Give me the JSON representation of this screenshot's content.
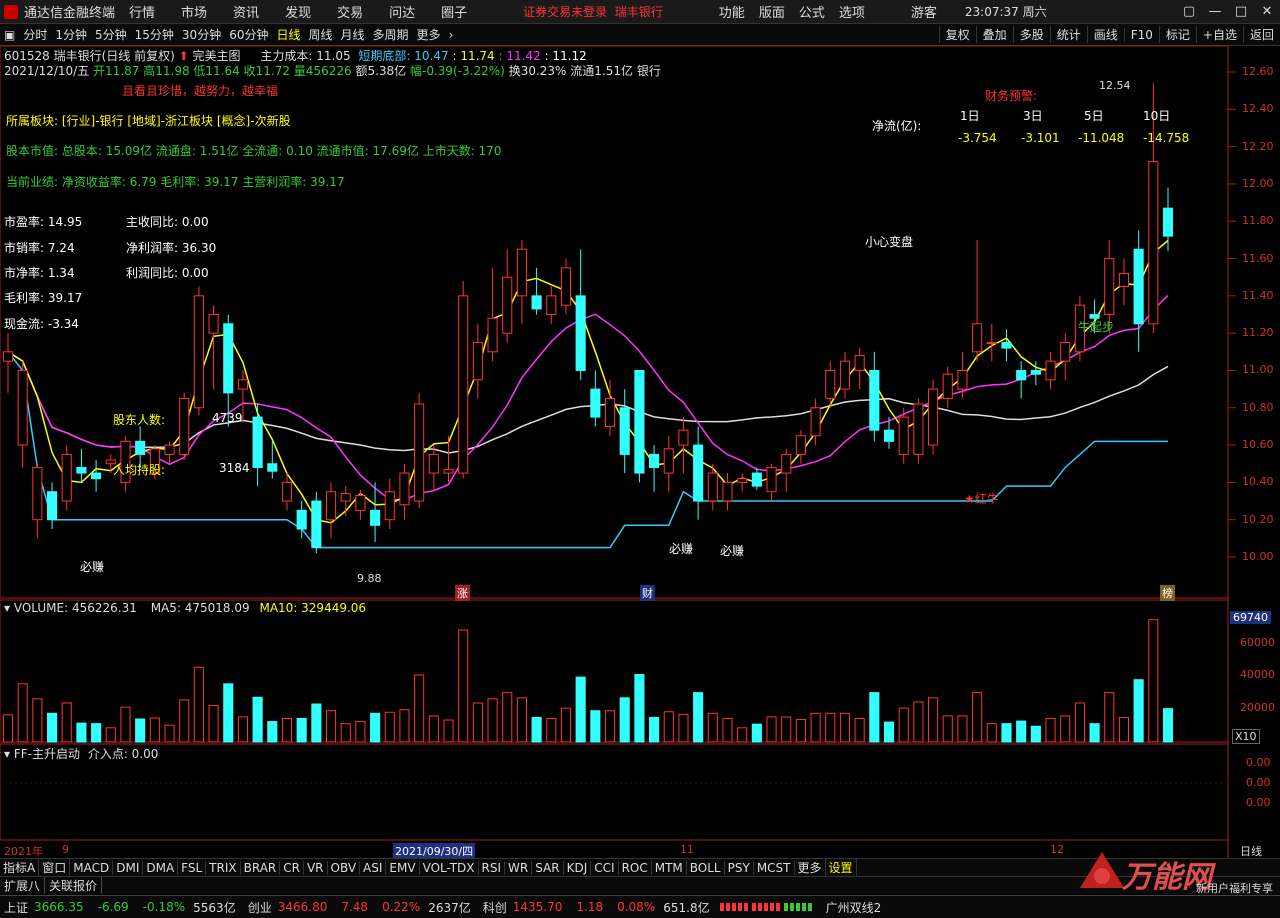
{
  "app": {
    "title": "通达信金融终端",
    "notice": "证券交易未登录",
    "notice_stock": "瑞丰银行",
    "guest": "游客",
    "clock": "23:07:37 周六"
  },
  "menus": [
    "行情",
    "市场",
    "资讯",
    "发现",
    "交易",
    "问达",
    "圈子"
  ],
  "right_menus": [
    "功能",
    "版面",
    "公式",
    "选项"
  ],
  "period_tabs": [
    "分时",
    "1分钟",
    "5分钟",
    "15分钟",
    "30分钟",
    "60分钟",
    "日线",
    "周线",
    "月线",
    "多周期",
    "更多"
  ],
  "active_period": "日线",
  "right_tools": [
    "复权",
    "叠加",
    "多股",
    "统计",
    "画线",
    "F10",
    "标记",
    "+自选",
    "返回"
  ],
  "stock": {
    "header": "601528 瑞丰银行(日线 前复权)",
    "main_chart": "完美主图",
    "cost": "主力成本: 11.05",
    "short_bottom_label": "短期底部:",
    "v1": "10.47",
    "v2": ": 11.74",
    "v3": ": 11.42",
    "v4": ": 11.12",
    "date": "2021/12/10/五",
    "open": "开11.87",
    "high": "高11.98",
    "low": "低11.64",
    "close": "收11.72",
    "volume": "量456226",
    "amount": "额5.38亿",
    "change": "幅-0.39(-3.22%)",
    "turnover": "换30.23%",
    "float": "流通1.51亿",
    "sector": "银行"
  },
  "overlay": {
    "motto": "且看且珍惜，越努力，越幸福",
    "industry": "所属板块: [行业]-银行 [地域]-浙江板块 [概念]-次新股",
    "capital": "股本市值: 总股本: 15.09亿 流通盘: 1.51亿 全流通: 0.10 流通市值: 17.69亿 上市天数: 170",
    "performance": "当前业绩: 净资收益率: 6.79 毛利率: 39.17 主营利润率: 39.17",
    "pe": "市盈率: 14.95",
    "ps": "市销率: 7.24",
    "pb": "市净率: 1.34",
    "gross": "毛利率: 39.17",
    "cashflow": "现金流: -3.34",
    "rev_yoy": "主收同比: 0.00",
    "net_margin": "净利润率: 36.30",
    "profit_yoy": "利润同比: 0.00",
    "holders_label": "股东人数:",
    "holders": "4739",
    "per_holder_label": "人均持股:",
    "per_holder": "3184",
    "finance_warn": "财务预警:",
    "netflow_label": "净流(亿):",
    "netflow_periods": [
      "1日",
      "3日",
      "5日",
      "10日"
    ],
    "netflow_values": [
      "-3.754",
      "-3.101",
      "-11.048",
      "-14.758"
    ],
    "caution": "小心变盘",
    "hongniu": "★红牛",
    "qidong": "牛起步",
    "bizhuan": "必赚",
    "high_mark": "12.54",
    "low_mark": "9.88",
    "zhang": "涨",
    "cai": "财",
    "bang": "榜"
  },
  "price_axis": [
    "12.60",
    "12.40",
    "12.20",
    "12.00",
    "11.80",
    "11.60",
    "11.40",
    "11.20",
    "11.00",
    "10.80",
    "10.60",
    "10.40",
    "10.20",
    "10.00"
  ],
  "volume_panel": {
    "label": "VOLUME: 456226.31",
    "ma5": "MA5: 475018.09",
    "ma10": "MA10: 329449.06",
    "axis": [
      "60000",
      "40000",
      "20000"
    ],
    "badge": "69740",
    "unit": "X10"
  },
  "ff_panel": {
    "label": "FF-主升启动",
    "entry": "介入点: 0.00",
    "axis": [
      "0.00",
      "0.00",
      "0.00"
    ]
  },
  "time_axis": {
    "year": "2021年",
    "m9": "9",
    "cursor_date": "2021/09/30/四",
    "m11": "11",
    "m12": "12",
    "period": "日线"
  },
  "indicators": [
    "指标A",
    "窗口",
    "MACD",
    "DMI",
    "DMA",
    "FSL",
    "TRIX",
    "BRAR",
    "CR",
    "VR",
    "OBV",
    "ASI",
    "EMV",
    "VOL-TDX",
    "RSI",
    "WR",
    "SAR",
    "KDJ",
    "CCI",
    "ROC",
    "MTM",
    "BOLL",
    "PSY",
    "MCST",
    "更多",
    "设置"
  ],
  "bottom_tabs": [
    "扩展八",
    "关联报价"
  ],
  "watermark": "万能网",
  "watermark_sub": "新用户福利专享",
  "quotes": {
    "sh_name": "上证",
    "sh_val": "3666.35",
    "sh_chg": "-6.69",
    "sh_pct": "-0.18%",
    "sh_amt": "5563亿",
    "cy_name": "创业",
    "cy_val": "3466.80",
    "cy_chg": "7.48",
    "cy_pct": "0.22%",
    "cy_amt": "2637亿",
    "kc_name": "科创",
    "kc_val": "1435.70",
    "kc_chg": "1.18",
    "kc_pct": "0.08%",
    "kc_amt": "651.8亿",
    "server": "广州双线2"
  },
  "chart_data": {
    "type": "candlestick",
    "price_range": [
      9.88,
      12.54
    ],
    "candles": [
      [
        11.05,
        11.2,
        10.88,
        11.1
      ],
      [
        10.6,
        11.05,
        10.48,
        11.0
      ],
      [
        10.2,
        10.5,
        10.1,
        10.48
      ],
      [
        10.35,
        10.4,
        10.15,
        10.2
      ],
      [
        10.3,
        10.6,
        10.25,
        10.55
      ],
      [
        10.48,
        10.58,
        10.4,
        10.45
      ],
      [
        10.45,
        10.52,
        10.35,
        10.42
      ],
      [
        10.5,
        10.55,
        10.45,
        10.52
      ],
      [
        10.4,
        10.65,
        10.35,
        10.62
      ],
      [
        10.62,
        10.7,
        10.48,
        10.55
      ],
      [
        10.45,
        10.6,
        10.42,
        10.58
      ],
      [
        10.55,
        10.62,
        10.5,
        10.6
      ],
      [
        10.55,
        10.88,
        10.52,
        10.85
      ],
      [
        10.8,
        11.45,
        10.76,
        11.4
      ],
      [
        11.2,
        11.35,
        10.9,
        11.3
      ],
      [
        11.25,
        11.3,
        10.7,
        10.88
      ],
      [
        10.9,
        11.0,
        10.72,
        10.95
      ],
      [
        10.75,
        10.82,
        10.38,
        10.48
      ],
      [
        10.5,
        10.62,
        10.42,
        10.46
      ],
      [
        10.3,
        10.45,
        10.25,
        10.4
      ],
      [
        10.25,
        10.3,
        10.1,
        10.15
      ],
      [
        10.3,
        10.35,
        10.02,
        10.05
      ],
      [
        10.2,
        10.4,
        10.1,
        10.35
      ],
      [
        10.3,
        10.38,
        10.22,
        10.34
      ],
      [
        10.25,
        10.36,
        10.2,
        10.33
      ],
      [
        10.25,
        10.4,
        10.08,
        10.17
      ],
      [
        10.2,
        10.42,
        10.15,
        10.35
      ],
      [
        10.28,
        10.5,
        10.2,
        10.45
      ],
      [
        10.3,
        10.88,
        10.26,
        10.82
      ],
      [
        10.45,
        10.6,
        10.35,
        10.55
      ],
      [
        10.45,
        10.65,
        10.4,
        10.47
      ],
      [
        10.45,
        11.48,
        10.42,
        11.4
      ],
      [
        10.95,
        11.25,
        10.85,
        11.15
      ],
      [
        11.1,
        11.55,
        11.05,
        11.28
      ],
      [
        11.2,
        11.65,
        11.15,
        11.5
      ],
      [
        11.4,
        11.7,
        11.25,
        11.65
      ],
      [
        11.4,
        11.55,
        11.3,
        11.33
      ],
      [
        11.3,
        11.45,
        11.25,
        11.4
      ],
      [
        11.35,
        11.6,
        11.3,
        11.55
      ],
      [
        11.4,
        11.65,
        10.95,
        11.0
      ],
      [
        10.9,
        11.0,
        10.7,
        10.75
      ],
      [
        10.7,
        10.95,
        10.65,
        10.85
      ],
      [
        10.8,
        10.9,
        10.45,
        10.55
      ],
      [
        11.0,
        11.0,
        10.4,
        10.45
      ],
      [
        10.55,
        10.6,
        10.35,
        10.48
      ],
      [
        10.45,
        10.65,
        10.35,
        10.58
      ],
      [
        10.6,
        10.75,
        10.45,
        10.68
      ],
      [
        10.6,
        10.7,
        10.2,
        10.3
      ],
      [
        10.3,
        10.5,
        10.25,
        10.45
      ],
      [
        10.3,
        10.45,
        10.25,
        10.4
      ],
      [
        10.4,
        10.45,
        10.35,
        10.42
      ],
      [
        10.45,
        10.48,
        10.36,
        10.38
      ],
      [
        10.35,
        10.5,
        10.3,
        10.48
      ],
      [
        10.45,
        10.58,
        10.35,
        10.55
      ],
      [
        10.55,
        10.68,
        10.5,
        10.65
      ],
      [
        10.65,
        10.85,
        10.6,
        10.8
      ],
      [
        10.85,
        11.05,
        10.8,
        11.0
      ],
      [
        10.9,
        11.1,
        10.85,
        11.05
      ],
      [
        11.0,
        11.12,
        10.9,
        11.08
      ],
      [
        11.0,
        11.1,
        10.62,
        10.68
      ],
      [
        10.68,
        10.75,
        10.58,
        10.62
      ],
      [
        10.55,
        10.8,
        10.5,
        10.75
      ],
      [
        10.55,
        10.85,
        10.5,
        10.82
      ],
      [
        10.6,
        10.95,
        10.55,
        10.9
      ],
      [
        10.85,
        11.02,
        10.8,
        10.98
      ],
      [
        10.9,
        11.1,
        10.85,
        11.0
      ],
      [
        11.1,
        11.7,
        11.05,
        11.25
      ],
      [
        11.15,
        11.25,
        11.05,
        11.15
      ],
      [
        11.15,
        11.22,
        11.05,
        11.12
      ],
      [
        11.0,
        11.05,
        10.85,
        10.95
      ],
      [
        11.0,
        11.05,
        10.92,
        10.98
      ],
      [
        10.95,
        11.1,
        10.9,
        11.05
      ],
      [
        11.05,
        11.2,
        10.95,
        11.15
      ],
      [
        11.1,
        11.4,
        11.05,
        11.35
      ],
      [
        11.3,
        11.38,
        11.2,
        11.28
      ],
      [
        11.3,
        11.7,
        11.2,
        11.6
      ],
      [
        11.45,
        11.6,
        11.35,
        11.52
      ],
      [
        11.65,
        11.75,
        11.1,
        11.25
      ],
      [
        11.25,
        12.54,
        11.2,
        12.12
      ],
      [
        11.87,
        11.98,
        11.64,
        11.72
      ]
    ]
  }
}
